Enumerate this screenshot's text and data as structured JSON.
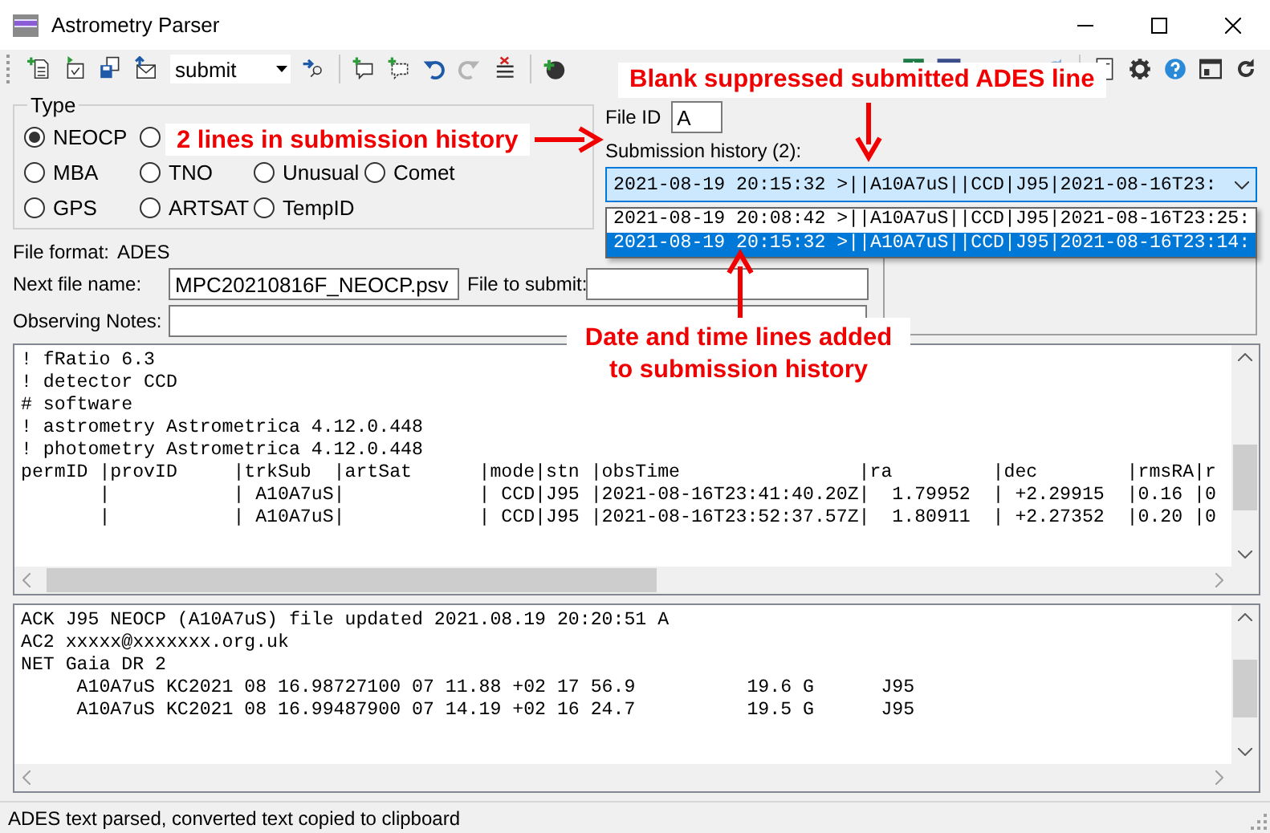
{
  "window": {
    "title": "Astrometry Parser"
  },
  "toolbar": {
    "mode_select": {
      "value": "submit"
    }
  },
  "type_group": {
    "title": "Type",
    "rows": [
      [
        {
          "label": "NEOCP",
          "selected": true
        },
        {
          "selected": false
        }
      ],
      [
        {
          "label": "MBA",
          "selected": false
        },
        {
          "label": "TNO",
          "selected": false
        },
        {
          "label": "Unusual",
          "selected": false
        },
        {
          "label": "Comet",
          "selected": false
        }
      ],
      [
        {
          "label": "GPS",
          "selected": false
        },
        {
          "label": "ARTSAT",
          "selected": false
        },
        {
          "label": "TempID",
          "selected": false
        }
      ]
    ]
  },
  "file_id": {
    "label": "File ID",
    "value": "A"
  },
  "submission_history": {
    "label": "Submission history (2):",
    "value": "2021-08-19 20:15:32 >||A10A7uS||CCD|J95|2021-08-16T23:",
    "items": [
      {
        "text": "2021-08-19 20:08:42 >||A10A7uS||CCD|J95|2021-08-16T23:25:",
        "selected": false
      },
      {
        "text": "2021-08-19 20:15:32 >||A10A7uS||CCD|J95|2021-08-16T23:14:",
        "selected": true
      }
    ]
  },
  "file_format": {
    "label": "File format:",
    "value": "ADES"
  },
  "next_file_name": {
    "label": "Next file name:",
    "value": "MPC20210816F_NEOCP.psv"
  },
  "file_to_submit": {
    "label": "File to submit:"
  },
  "observing_notes": {
    "label": "Observing Notes:"
  },
  "ades_text": {
    "lines": [
      "! fRatio 6.3",
      "! detector CCD",
      "# software",
      "! astrometry Astrometrica 4.12.0.448",
      "! photometry Astrometrica 4.12.0.448",
      "permID |provID     |trkSub  |artSat      |mode|stn |obsTime                |ra         |dec        |rmsRA|r",
      "       |           | A10A7uS|            | CCD|J95 |2021-08-16T23:41:40.20Z|  1.79952  | +2.29915  |0.16 |0",
      "       |           | A10A7uS|            | CCD|J95 |2021-08-16T23:52:37.57Z|  1.80911  | +2.27352  |0.20 |0"
    ]
  },
  "mpc_text": {
    "lines": [
      "ACK J95 NEOCP (A10A7uS) file updated 2021.08.19 20:20:51 A",
      "AC2 xxxxx@xxxxxxx.org.uk",
      "NET Gaia DR 2",
      "     A10A7uS KC2021 08 16.98727100 07 11.88 +02 17 56.9          19.6 G      J95",
      "     A10A7uS KC2021 08 16.99487900 07 14.19 +02 16 24.7          19.5 G      J95"
    ]
  },
  "status_bar": {
    "text": "ADES text parsed, converted text copied to clipboard"
  },
  "annotations": [
    {
      "text": "2 lines in submission history",
      "kind": "right"
    },
    {
      "text": "Blank suppressed submitted ADES line",
      "kind": "down"
    },
    {
      "text": "Date and time lines added to submission history",
      "kind": "up"
    }
  ]
}
